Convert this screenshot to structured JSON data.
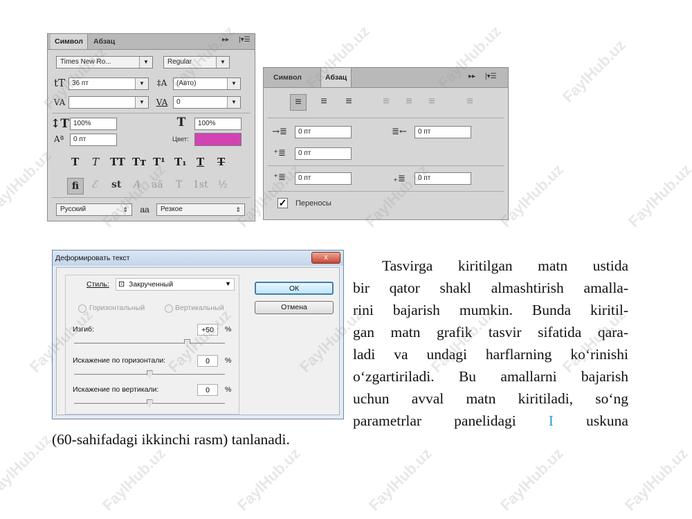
{
  "char_panel": {
    "tab_symbol": "Символ",
    "tab_paragraph": "Абзац",
    "font_family": "Times New Ro...",
    "font_style": "Regular",
    "font_size": "36 пт",
    "leading": "(Авто)",
    "kerning": "",
    "tracking": "0",
    "vertical_scale": "100%",
    "horizontal_scale": "100%",
    "baseline_shift": "0 пт",
    "color_label": "Цвет:",
    "color_value": "#d244b4",
    "style_buttons": [
      "T",
      "T",
      "TT",
      "Tт",
      "T¹",
      "T₁",
      "T",
      "T"
    ],
    "opentype_buttons": [
      "fi",
      "ℰ",
      "st",
      "A",
      "aā",
      "T",
      "1st",
      "½"
    ],
    "language": "Русский",
    "aa_icon_text": "aa",
    "antialias": "Резкое"
  },
  "para_panel": {
    "tab_symbol": "Символ",
    "tab_paragraph": "Абзац",
    "indent_left": "0 пт",
    "indent_right": "0 пт",
    "indent_first": "0 пт",
    "space_before": "0 пт",
    "space_after": "0 пт",
    "hyphenate_label": "Переносы",
    "hyphenate_checked": true
  },
  "warp_dialog": {
    "title": "Деформировать текст",
    "close_glyph": "x",
    "style_label": "Стиль:",
    "style_value": "Закрученный",
    "horizontal_label": "Горизонтальный",
    "vertical_label": "Вертикальный",
    "bend_label": "Изгиб:",
    "bend_value": "+50",
    "hdist_label": "Искажение по горизонтали:",
    "hdist_value": "0",
    "vdist_label": "Искажение по вертикали:",
    "vdist_value": "0",
    "percent": "%",
    "ok_label": "ОК",
    "cancel_label": "Отмена",
    "bend_level": 0.75,
    "hdist_level": 0.5,
    "vdist_level": 0.5
  },
  "text": {
    "line1": "Tasvirga  kiritilgan matn ustida",
    "line2": "bir qator shakl almashtirish amalla-",
    "line3": "rini bajarish mumkin. Bunda kiritil-",
    "line4": "gan matn grafik tasvir sifatida qara-",
    "line5": "ladi va undagi harflarning ko‘rinishi",
    "line6": "o‘zgartiriladi. Bu amallarni bajarish",
    "line7": "uchun avval matn kiritiladi, so‘ng",
    "line8_a": "parametrlar",
    "line8_b": "panelidagi",
    "tool_glyph": "I",
    "line8_c": "uskuna",
    "last_line": "(60-sahifadagi ikkinchi rasm) tanlanadi."
  },
  "watermark": "FaylHub.uz"
}
